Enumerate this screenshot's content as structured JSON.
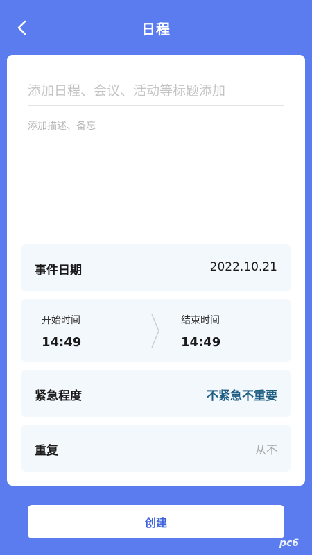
{
  "header": {
    "title": "日程"
  },
  "form": {
    "title_placeholder": "添加日程、会议、活动等标题添加",
    "desc_placeholder": "添加描述、备忘"
  },
  "event_date": {
    "label": "事件日期",
    "value": "2022.10.21"
  },
  "time": {
    "start_label": "开始时间",
    "start_value": "14:49",
    "end_label": "结束时间",
    "end_value": "14:49"
  },
  "urgency": {
    "label": "紧急程度",
    "value": "不紧急不重要"
  },
  "repeat": {
    "label": "重复",
    "value": "从不"
  },
  "actions": {
    "create_label": "创建"
  },
  "watermark": {
    "text": "pc6"
  },
  "colors": {
    "background": "#5b7cee",
    "urgency_value": "#1d5d82",
    "button_text": "#3f63db"
  }
}
